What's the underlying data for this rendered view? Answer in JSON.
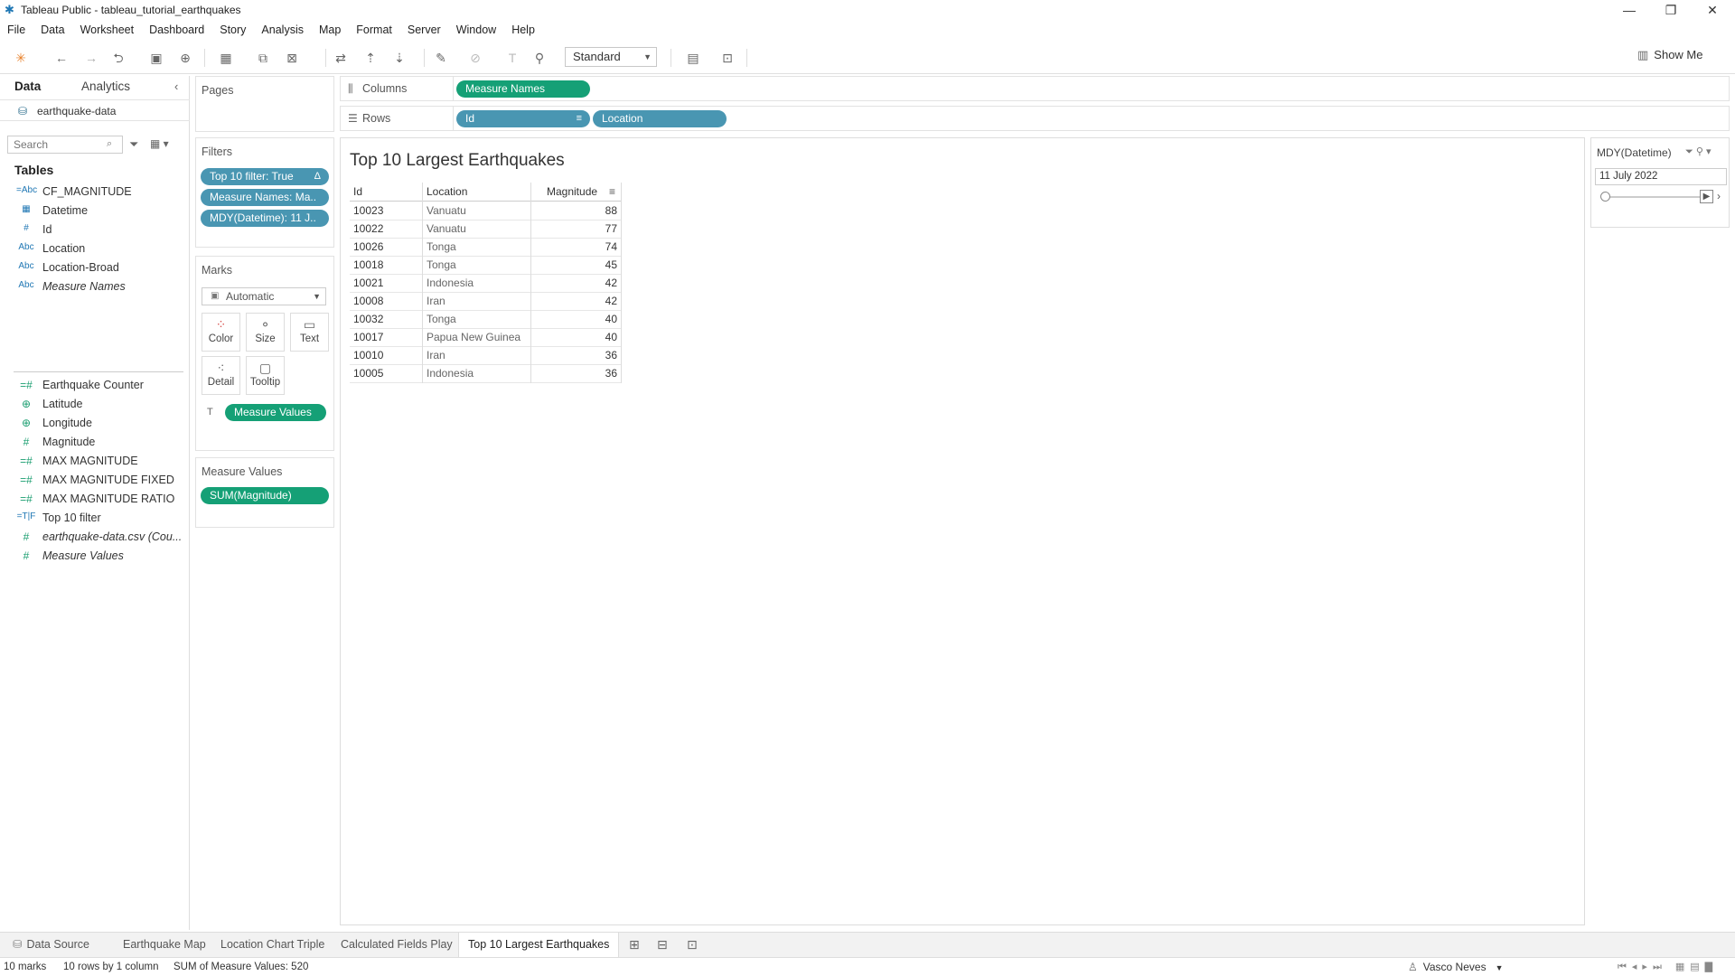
{
  "window": {
    "title": "Tableau Public - tableau_tutorial_earthquakes",
    "minimize": "—",
    "restore": "❐",
    "close": "✕"
  },
  "menu": [
    "File",
    "Data",
    "Worksheet",
    "Dashboard",
    "Story",
    "Analysis",
    "Map",
    "Format",
    "Server",
    "Window",
    "Help"
  ],
  "toolbar": {
    "fit_select": "Standard",
    "show_me": "Show Me"
  },
  "data_pane": {
    "tab_data": "Data",
    "tab_analytics": "Analytics",
    "datasource": "earthquake-data",
    "search_placeholder": "Search",
    "tables_header": "Tables",
    "fields": [
      {
        "type": "=Abc",
        "name": "CF_MAGNITUDE"
      },
      {
        "type": "▦",
        "name": "Datetime"
      },
      {
        "type": "#",
        "name": "Id"
      },
      {
        "type": "Abc",
        "name": "Location"
      },
      {
        "type": "Abc",
        "name": "Location-Broad"
      },
      {
        "type": "Abc",
        "name": "Measure Names"
      },
      {
        "type": "=#",
        "name": "Earthquake Counter"
      },
      {
        "type": "⊕",
        "name": "Latitude"
      },
      {
        "type": "⊕",
        "name": "Longitude"
      },
      {
        "type": "#",
        "name": "Magnitude"
      },
      {
        "type": "=#",
        "name": "MAX MAGNITUDE"
      },
      {
        "type": "=#",
        "name": "MAX MAGNITUDE FIXED"
      },
      {
        "type": "=#",
        "name": "MAX MAGNITUDE RATIO"
      },
      {
        "type": "=T|F",
        "name": "Top 10 filter"
      },
      {
        "type": "#",
        "name": "earthquake-data.csv (Cou..."
      },
      {
        "type": "#",
        "name": "Measure Values"
      }
    ]
  },
  "cards": {
    "pages_title": "Pages",
    "filters_title": "Filters",
    "filters": [
      "Top 10 filter: True",
      "Measure Names: Ma..",
      "MDY(Datetime): 11 J.."
    ],
    "marks_title": "Marks",
    "marks_type": "Automatic",
    "mark_buttons": [
      "Color",
      "Size",
      "Text",
      "Detail",
      "Tooltip"
    ],
    "marks_pill": "Measure Values",
    "measure_values_title": "Measure Values",
    "measure_values_pill": "SUM(Magnitude)"
  },
  "shelves": {
    "columns_label": "Columns",
    "columns_pill": "Measure Names",
    "rows_label": "Rows",
    "rows_pills": [
      "Id",
      "Location"
    ]
  },
  "sheet": {
    "title": "Top 10 Largest Earthquakes",
    "headers": {
      "id": "Id",
      "location": "Location",
      "magnitude": "Magnitude"
    },
    "rows": [
      {
        "id": "10023",
        "location": "Vanuatu",
        "magnitude": "88"
      },
      {
        "id": "10022",
        "location": "Vanuatu",
        "magnitude": "77"
      },
      {
        "id": "10026",
        "location": "Tonga",
        "magnitude": "74"
      },
      {
        "id": "10018",
        "location": "Tonga",
        "magnitude": "45"
      },
      {
        "id": "10021",
        "location": "Indonesia",
        "magnitude": "42"
      },
      {
        "id": "10008",
        "location": "Iran",
        "magnitude": "42"
      },
      {
        "id": "10032",
        "location": "Tonga",
        "magnitude": "40"
      },
      {
        "id": "10017",
        "location": "Papua New Guinea",
        "magnitude": "40"
      },
      {
        "id": "10010",
        "location": "Iran",
        "magnitude": "36"
      },
      {
        "id": "10005",
        "location": "Indonesia",
        "magnitude": "36"
      }
    ]
  },
  "filter_card": {
    "title": "MDY(Datetime)",
    "value": "11 July 2022"
  },
  "sheet_tabs": [
    "Data Source",
    "Earthquake Map",
    "Location Chart Triple",
    "Calculated Fields Play",
    "Top 10 Largest Earthquakes"
  ],
  "status": {
    "marks": "10 marks",
    "dims": "10 rows by 1 column",
    "sum": "SUM of Measure Values: 520",
    "user": "Vasco Neves"
  },
  "colors": {
    "dimension_pill": "#4996b2",
    "measure_pill": "#15a076"
  }
}
